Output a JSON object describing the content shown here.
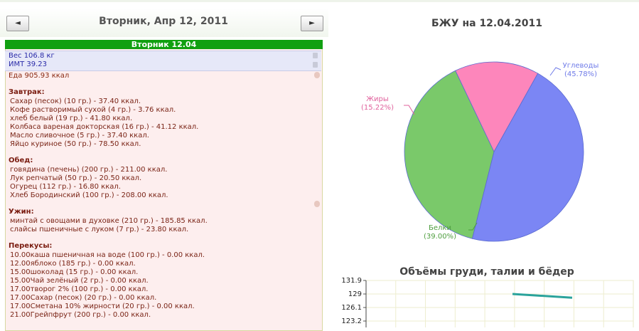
{
  "nav": {
    "prev_label": "◄",
    "next_label": "►",
    "date_title": "Вторник, Апр 12, 2011"
  },
  "day": {
    "header": "Вторник 12.04",
    "weight": "Вес 106.8 кг",
    "bmi": "ИМТ 39.23",
    "food_total": "Еда 905.93 ккал"
  },
  "meals": [
    {
      "title": "Завтрак:",
      "items": [
        "Сахар (песок) (10 гр.) - 37.40 ккал.",
        "Кофе растворимый сухой (4 гр.) - 3.76 ккал.",
        "хлеб белый (19 гр.) - 41.80 ккал.",
        "Колбаса вареная докторская (16 гр.) - 41.12 ккал.",
        "Масло сливочное (5 гр.) - 37.40 ккал.",
        "Яйцо куриное (50 гр.) - 78.50 ккал."
      ]
    },
    {
      "title": "Обед:",
      "items": [
        "говядина (печень) (200 гр.) - 211.00 ккал.",
        "Лук репчатый (50 гр.) - 20.50 ккал.",
        "Огурец (112 гр.) - 16.80 ккал.",
        "Хлеб Бородинский (100 гр.) - 208.00 ккал."
      ]
    },
    {
      "title": "Ужин:",
      "items": [
        "минтай с овощами в духовке (210 гр.) - 185.85 ккал.",
        "слайсы пшеничные с луком (7 гр.) - 23.80 ккал."
      ]
    },
    {
      "title": "Перекусы:",
      "items": [
        "10.00каша пшеничная на воде (100 гр.) - 0.00 ккал.",
        "12.00яблоко (185 гр.) - 0.00 ккал.",
        "15.00шоколад (15 гр.) - 0.00 ккал.",
        "15.00Чай зелёный (2 гр.) - 0.00 ккал.",
        "17.00творог 2% (100 гр.) - 0.00 ккал.",
        "17.00Сахар (песок) (20 гр.) - 0.00 ккал.",
        "17.00Сметана 10% жирности (20 гр.) - 0.00 ккал.",
        "21.00Грейпфрут (200 гр.) - 0.00 ккал."
      ]
    }
  ],
  "colors": {
    "carbs": "#7b86f4",
    "protein": "#7ac96a",
    "fat": "#fd86bb"
  },
  "chart_data": [
    {
      "type": "pie",
      "title": "БЖУ на 12.04.2011",
      "slices": [
        {
          "label": "Углеводы",
          "pct_label": "(45.78%)",
          "value": 45.78
        },
        {
          "label": "Белки",
          "pct_label": "(39.00%)",
          "value": 39.0
        },
        {
          "label": "Жиры",
          "pct_label": "(15.22%)",
          "value": 15.22
        }
      ]
    },
    {
      "type": "line",
      "title": "Объёмы груди, талии и бёдер",
      "y_ticks": [
        "131.9",
        "129",
        "126.1",
        "123.2"
      ],
      "series": [
        {
          "values": [
            129,
            128.2
          ]
        }
      ],
      "grid": true
    }
  ]
}
